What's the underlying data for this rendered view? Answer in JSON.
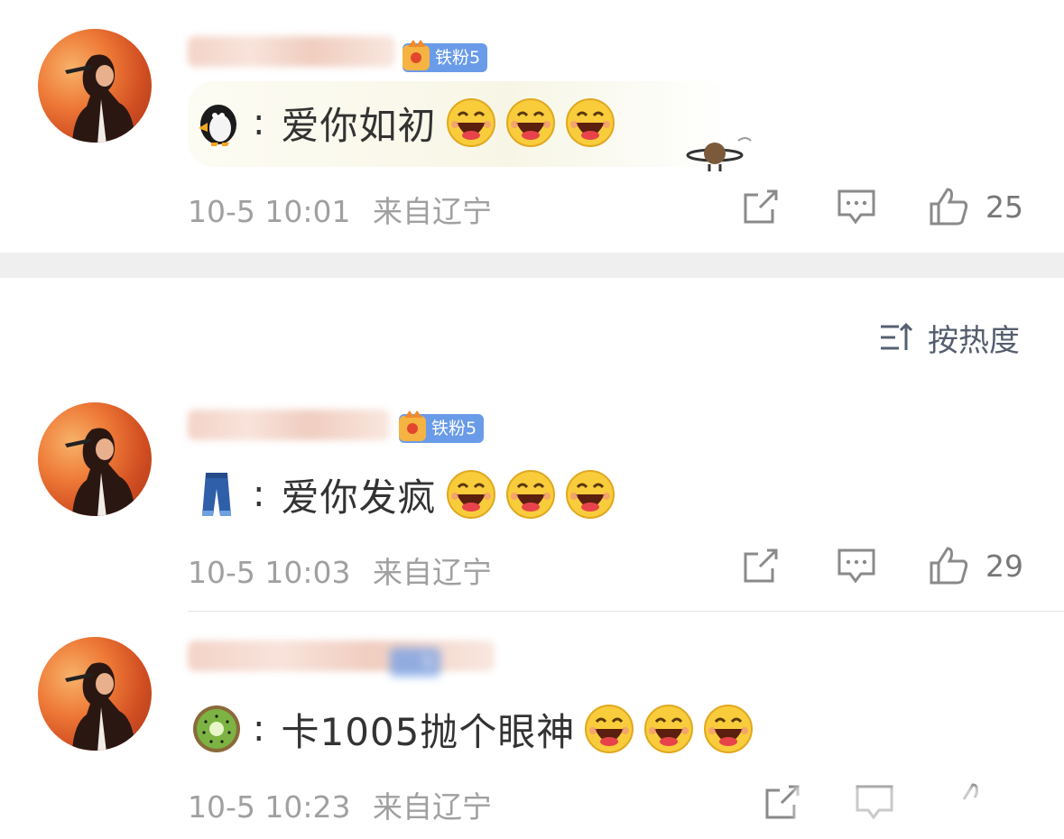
{
  "sort": {
    "label": "按热度"
  },
  "comments": [
    {
      "badge": "铁粉5",
      "prefix_emoji": "penguin-icon",
      "text": "爱你如初",
      "time": "10-5 10:01",
      "location": "来自辽宁",
      "likes": "25"
    },
    {
      "badge": "铁粉5",
      "prefix_emoji": "jeans-icon",
      "text": "爱你发疯",
      "time": "10-5 10:03",
      "location": "来自辽宁",
      "likes": "29"
    },
    {
      "badge": "5",
      "prefix_emoji": "kiwi-icon",
      "text": "卡1005抛个眼神",
      "time": "10-5 10:23",
      "location": "来自辽宁",
      "likes": ""
    }
  ],
  "colors": {
    "badge": "#6a9be9",
    "meta_text": "#a0a0a0",
    "separator": "#efefef"
  }
}
